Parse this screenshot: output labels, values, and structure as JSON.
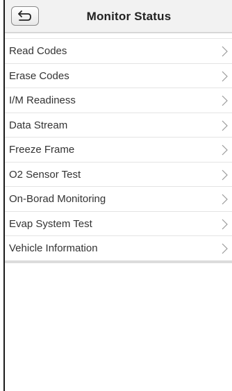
{
  "header": {
    "title": "Monitor Status",
    "back_icon": "return-arrow-icon"
  },
  "menu": {
    "items": [
      {
        "label": "Read Codes",
        "icon": "chevron-right-icon"
      },
      {
        "label": "Erase Codes",
        "icon": "chevron-right-icon"
      },
      {
        "label": "I/M Readiness",
        "icon": "chevron-right-icon"
      },
      {
        "label": "Data Stream",
        "icon": "chevron-right-icon"
      },
      {
        "label": "Freeze Frame",
        "icon": "chevron-right-icon"
      },
      {
        "label": "O2 Sensor Test",
        "icon": "chevron-right-icon"
      },
      {
        "label": "On-Borad Monitoring",
        "icon": "chevron-right-icon"
      },
      {
        "label": "Evap System Test",
        "icon": "chevron-right-icon"
      },
      {
        "label": "Vehicle Information",
        "icon": "chevron-right-icon"
      }
    ]
  },
  "colors": {
    "header_bg": "#f2f2f2",
    "text": "#333333",
    "divider": "#e4e4e4",
    "chevron": "#9a9a9a"
  }
}
